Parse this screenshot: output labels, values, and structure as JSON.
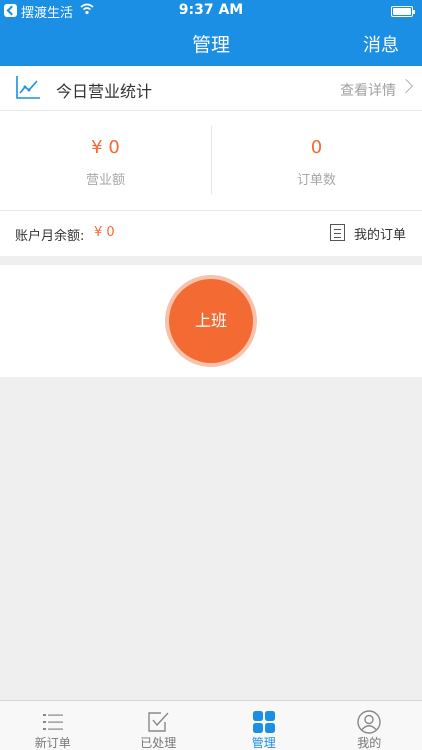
{
  "status_bar": {
    "app_name": "摆渡生活",
    "time": "9:37 AM"
  },
  "nav": {
    "title": "管理",
    "right_label": "消息"
  },
  "stats_header": {
    "title": "今日营业统计",
    "more_label": "查看详情"
  },
  "stats": {
    "revenue_value": "¥ 0",
    "revenue_label": "营业额",
    "orders_value": "0",
    "orders_label": "订单数"
  },
  "balance": {
    "label": "账户月余额:",
    "value": "¥ 0",
    "my_orders_label": "我的订单"
  },
  "clock_in": {
    "label": "上班"
  },
  "tabs": [
    {
      "label": "新订单",
      "icon": "list-icon"
    },
    {
      "label": "已处理",
      "icon": "checkbox-icon"
    },
    {
      "label": "管理",
      "icon": "grid-icon",
      "active": true
    },
    {
      "label": "我的",
      "icon": "profile-icon"
    }
  ],
  "colors": {
    "primary": "#1b8fe3",
    "accent": "#f46a33",
    "background": "#efefef"
  }
}
